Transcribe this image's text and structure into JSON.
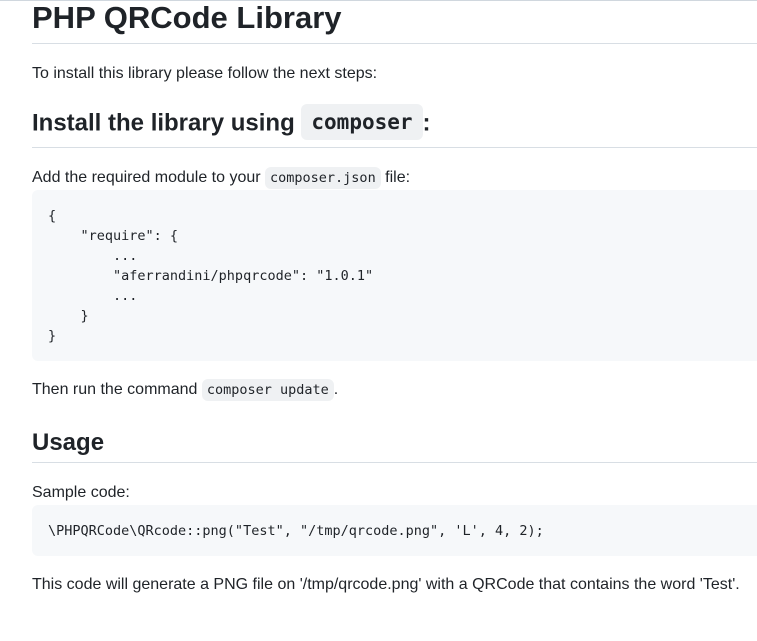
{
  "doc": {
    "title": "PHP QRCode Library",
    "intro": "To install this library please follow the next steps:",
    "install_heading": {
      "prefix": "Install the library using ",
      "code": "composer",
      "suffix": ":"
    },
    "add_paragraph": {
      "prefix": "Add the required module to your ",
      "code": "composer.json",
      "suffix": " file:"
    },
    "json_code": "{\n    \"require\": {\n        ...\n        \"aferrandini/phpqrcode\": \"1.0.1\"\n        ...\n    }\n}",
    "then_paragraph": {
      "prefix": "Then run the command ",
      "code": "composer update",
      "suffix": "."
    },
    "usage_heading": "Usage",
    "sample_label": "Sample code:",
    "usage_code": "\\PHPQRCode\\QRcode::png(\"Test\", \"/tmp/qrcode.png\", 'L', 4, 2);",
    "final_paragraph": "This code will generate a PNG file on '/tmp/qrcode.png' with a QRCode that contains the word 'Test'."
  }
}
